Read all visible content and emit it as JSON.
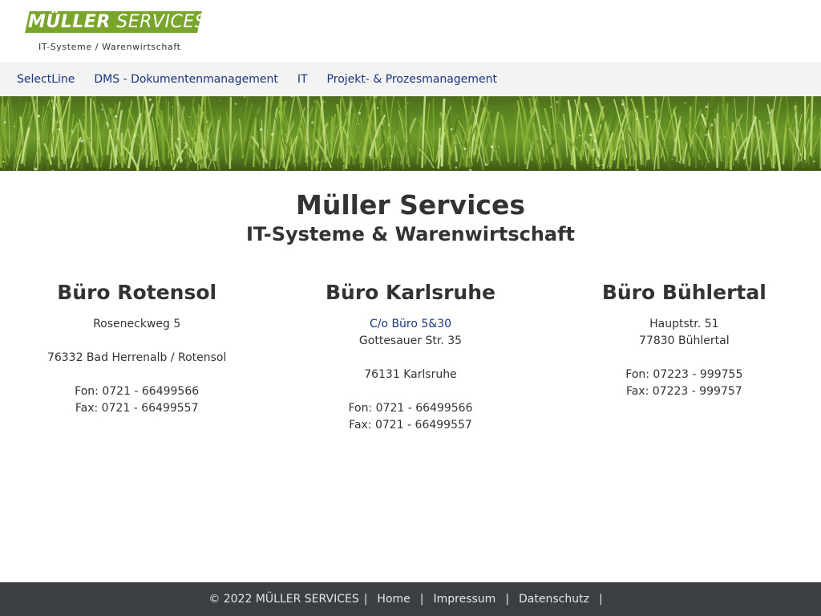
{
  "logo": {
    "brand_first": "MÜLLER",
    "brand_second": "SERVICES",
    "tagline": "IT-Systeme / Warenwirtschaft"
  },
  "nav": {
    "items": [
      {
        "label": "SelectLine"
      },
      {
        "label": "DMS - Dokumentenmanagement"
      },
      {
        "label": "IT"
      },
      {
        "label": "Projekt- & Prozesmanagement"
      }
    ]
  },
  "main": {
    "title": "Müller Services",
    "subtitle": "IT-Systeme & Warenwirtschaft"
  },
  "offices": [
    {
      "title": "Büro Rotensol",
      "lines": [
        "Roseneckweg 5",
        "",
        "76332 Bad Herrenalb / Rotensol",
        "",
        "Fon: 0721 - 66499566",
        "Fax: 0721 - 66499557"
      ]
    },
    {
      "title": "Büro Karlsruhe",
      "link": "C/o Büro 5&30",
      "lines": [
        "Gottesauer Str. 35",
        "",
        "76131 Karlsruhe",
        "",
        "Fon: 0721 - 66499566",
        "Fax: 0721 - 66499557"
      ]
    },
    {
      "title": "Büro Bühlertal",
      "lines": [
        "Hauptstr. 51",
        "77830 Bühlertal",
        "",
        "Fon: 07223 - 999755",
        "Fax: 07223 - 999757"
      ]
    }
  ],
  "footer": {
    "copyright": "© 2022 MÜLLER SERVICES",
    "separator": "|",
    "links": [
      {
        "label": "Home"
      },
      {
        "label": "Impressum"
      },
      {
        "label": "Datenschutz"
      }
    ]
  },
  "colors": {
    "brand_green": "#7aa52c",
    "link_blue": "#1a3580",
    "footer_bg": "#3a3f44",
    "nav_bg": "#f3f3f3"
  }
}
